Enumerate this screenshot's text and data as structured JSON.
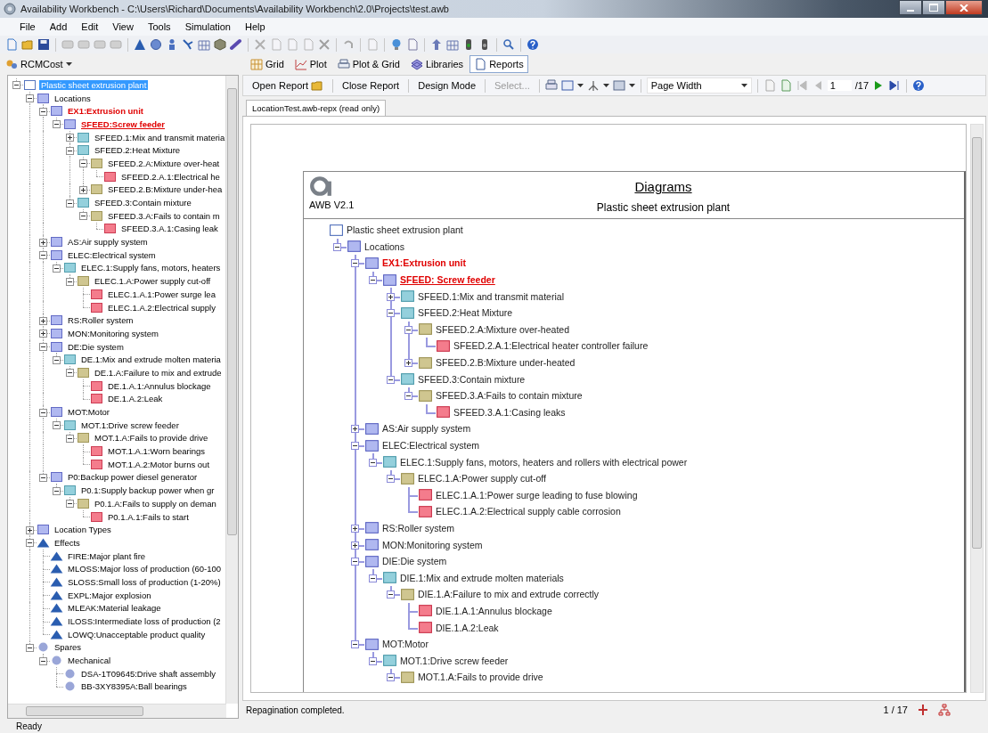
{
  "window": {
    "title": "Availability Workbench - C:\\Users\\Richard\\Documents\\Availability Workbench\\2.0\\Projects\\test.awb"
  },
  "menu": [
    "File",
    "Add",
    "Edit",
    "View",
    "Tools",
    "Simulation",
    "Help"
  ],
  "navigator": {
    "module": "RCMCost",
    "tree": [
      {
        "label": "Plastic sheet extrusion plant",
        "kind": "root",
        "selected": true,
        "expanded": true,
        "children": [
          {
            "label": "Locations",
            "kind": "location",
            "selected": false,
            "expanded": true,
            "children": [
              {
                "label": "EX1:Extrusion unit",
                "kind": "location",
                "color": "#e00000",
                "selected": false,
                "expanded": true,
                "children": [
                  {
                    "label": "SFEED:Screw feeder",
                    "kind": "location",
                    "color": "#e00000",
                    "underlined": true,
                    "selected": false,
                    "expanded": true,
                    "children": [
                      {
                        "label": "SFEED.1:Mix and transmit materia",
                        "kind": "function",
                        "selected": false,
                        "expanded": false
                      },
                      {
                        "label": "SFEED.2:Heat Mixture",
                        "kind": "function",
                        "selected": false,
                        "expanded": true,
                        "children": [
                          {
                            "label": "SFEED.2.A:Mixture over-heat",
                            "kind": "failure",
                            "selected": false,
                            "expanded": true,
                            "children": [
                              {
                                "label": "SFEED.2.A.1:Electrical he",
                                "kind": "cause",
                                "selected": false
                              }
                            ]
                          },
                          {
                            "label": "SFEED.2.B:Mixture under-hea",
                            "kind": "failure",
                            "selected": false,
                            "expanded": false
                          }
                        ]
                      },
                      {
                        "label": "SFEED.3:Contain mixture",
                        "kind": "function",
                        "selected": false,
                        "expanded": true,
                        "children": [
                          {
                            "label": "SFEED.3.A:Fails to contain m",
                            "kind": "failure",
                            "selected": false,
                            "expanded": true,
                            "children": [
                              {
                                "label": "SFEED.3.A.1:Casing leak",
                                "kind": "cause",
                                "selected": false
                              }
                            ]
                          }
                        ]
                      }
                    ]
                  }
                ]
              },
              {
                "label": "AS:Air supply system",
                "kind": "location",
                "selected": false,
                "expanded": false
              },
              {
                "label": "ELEC:Electrical system",
                "kind": "location",
                "selected": false,
                "expanded": true,
                "children": [
                  {
                    "label": "ELEC.1:Supply fans, motors, heaters",
                    "kind": "function",
                    "selected": false,
                    "expanded": true,
                    "children": [
                      {
                        "label": "ELEC.1.A:Power supply cut-off",
                        "kind": "failure",
                        "selected": false,
                        "expanded": true,
                        "children": [
                          {
                            "label": "ELEC.1.A.1:Power surge lea",
                            "kind": "cause",
                            "selected": false
                          },
                          {
                            "label": "ELEC.1.A.2:Electrical supply",
                            "kind": "cause",
                            "selected": false
                          }
                        ]
                      }
                    ]
                  }
                ]
              },
              {
                "label": "RS:Roller system",
                "kind": "location",
                "selected": false,
                "expanded": false
              },
              {
                "label": "MON:Monitoring system",
                "kind": "location",
                "selected": false,
                "expanded": false
              },
              {
                "label": "DE:Die system",
                "kind": "location",
                "selected": false,
                "expanded": true,
                "children": [
                  {
                    "label": "DE.1:Mix and extrude molten materia",
                    "kind": "function",
                    "selected": false,
                    "expanded": true,
                    "children": [
                      {
                        "label": "DE.1.A:Failure to mix and extrude",
                        "kind": "failure",
                        "selected": false,
                        "expanded": true,
                        "children": [
                          {
                            "label": "DE.1.A.1:Annulus blockage",
                            "kind": "cause",
                            "selected": false
                          },
                          {
                            "label": "DE.1.A.2:Leak",
                            "kind": "cause",
                            "selected": false
                          }
                        ]
                      }
                    ]
                  }
                ]
              },
              {
                "label": "MOT:Motor",
                "kind": "location",
                "selected": false,
                "expanded": true,
                "children": [
                  {
                    "label": "MOT.1:Drive screw feeder",
                    "kind": "function",
                    "selected": false,
                    "expanded": true,
                    "children": [
                      {
                        "label": "MOT.1.A:Fails to provide drive",
                        "kind": "failure",
                        "selected": false,
                        "expanded": true,
                        "children": [
                          {
                            "label": "MOT.1.A.1:Worn bearings",
                            "kind": "cause",
                            "selected": false
                          },
                          {
                            "label": "MOT.1.A.2:Motor burns out",
                            "kind": "cause",
                            "selected": false
                          }
                        ]
                      }
                    ]
                  }
                ]
              },
              {
                "label": "P0:Backup power diesel generator",
                "kind": "location",
                "selected": false,
                "expanded": true,
                "children": [
                  {
                    "label": "P0.1:Supply backup power when gr",
                    "kind": "function",
                    "selected": false,
                    "expanded": true,
                    "children": [
                      {
                        "label": "P0.1.A:Fails to supply on deman",
                        "kind": "failure",
                        "selected": false,
                        "expanded": true,
                        "children": [
                          {
                            "label": "P0.1.A.1:Fails to start",
                            "kind": "cause",
                            "selected": false
                          }
                        ]
                      }
                    ]
                  }
                ]
              }
            ]
          },
          {
            "label": "Location Types",
            "kind": "location",
            "selected": false,
            "expanded": false
          },
          {
            "label": "Effects",
            "kind": "effect",
            "selected": false,
            "expanded": true,
            "children": [
              {
                "label": "FIRE:Major plant fire",
                "kind": "effect",
                "selected": false
              },
              {
                "label": "MLOSS:Major loss of production (60-100",
                "kind": "effect",
                "selected": false
              },
              {
                "label": "SLOSS:Small loss of production (1-20%)",
                "kind": "effect",
                "selected": false
              },
              {
                "label": "EXPL:Major explosion",
                "kind": "effect",
                "selected": false
              },
              {
                "label": "MLEAK:Material leakage",
                "kind": "effect",
                "selected": false
              },
              {
                "label": "ILOSS:Intermediate loss of production (2",
                "kind": "effect",
                "selected": false
              },
              {
                "label": "LOWQ:Unacceptable product quality",
                "kind": "effect",
                "selected": false
              }
            ]
          },
          {
            "label": "Spares",
            "kind": "spare",
            "selected": false,
            "expanded": true,
            "children": [
              {
                "label": "Mechanical",
                "kind": "spare",
                "selected": false,
                "expanded": true,
                "children": [
                  {
                    "label": "DSA-1T09645:Drive shaft assembly",
                    "kind": "spare",
                    "selected": false
                  },
                  {
                    "label": "BB-3XY8395A:Ball bearings",
                    "kind": "spare",
                    "selected": false
                  }
                ]
              }
            ]
          }
        ]
      }
    ]
  },
  "view_tabs": [
    {
      "label": "Grid",
      "selected": false
    },
    {
      "label": "Plot",
      "selected": false
    },
    {
      "label": "Plot & Grid",
      "selected": false
    },
    {
      "label": "Libraries",
      "selected": false
    },
    {
      "label": "Reports",
      "selected": true
    }
  ],
  "report_toolbar": {
    "buttons": [
      {
        "label": "Open Report",
        "disabled": false
      },
      {
        "label": "Close Report",
        "disabled": false
      },
      {
        "label": "Design Mode",
        "disabled": false
      },
      {
        "label": "Select...",
        "disabled": true
      }
    ],
    "zoom": "Page Width",
    "page": "1",
    "page_total": "/17"
  },
  "document_tab": "LocationTest.awb-repx (read only)",
  "report": {
    "logo_caption": "AWB V2.1",
    "heading": "Diagrams",
    "subtitle": "Plastic sheet extrusion plant",
    "tree": [
      {
        "label": "Plastic sheet extrusion plant",
        "kind": "root",
        "children": [
          {
            "label": "Locations",
            "kind": "location",
            "expanded": true,
            "children": [
              {
                "label": "EX1:Extrusion unit",
                "kind": "location",
                "color": "#e00000",
                "expanded": true,
                "children": [
                  {
                    "label": "SFEED: Screw feeder",
                    "kind": "location",
                    "color": "#e00000",
                    "underlined": true,
                    "expanded": true,
                    "children": [
                      {
                        "label": "SFEED.1:Mix and transmit material",
                        "kind": "function",
                        "expanded": false
                      },
                      {
                        "label": "SFEED.2:Heat Mixture",
                        "kind": "function",
                        "expanded": true,
                        "children": [
                          {
                            "label": "SFEED.2.A:Mixture over-heated",
                            "kind": "failure",
                            "expanded": true,
                            "children": [
                              {
                                "label": "SFEED.2.A.1:Electrical heater controller failure",
                                "kind": "cause"
                              }
                            ]
                          },
                          {
                            "label": "SFEED.2.B:Mixture under-heated",
                            "kind": "failure",
                            "expanded": false
                          }
                        ]
                      },
                      {
                        "label": "SFEED.3:Contain mixture",
                        "kind": "function",
                        "expanded": true,
                        "children": [
                          {
                            "label": "SFEED.3.A:Fails to contain mixture",
                            "kind": "failure",
                            "expanded": true,
                            "children": [
                              {
                                "label": "SFEED.3.A.1:Casing leaks",
                                "kind": "cause"
                              }
                            ]
                          }
                        ]
                      }
                    ]
                  }
                ]
              },
              {
                "label": "AS:Air supply system",
                "kind": "location",
                "expanded": false
              },
              {
                "label": "ELEC:Electrical system",
                "kind": "location",
                "expanded": true,
                "children": [
                  {
                    "label": "ELEC.1:Supply fans, motors, heaters and rollers with electrical power",
                    "kind": "function",
                    "expanded": true,
                    "children": [
                      {
                        "label": "ELEC.1.A:Power supply cut-off",
                        "kind": "failure",
                        "expanded": true,
                        "children": [
                          {
                            "label": "ELEC.1.A.1:Power surge leading to fuse blowing",
                            "kind": "cause"
                          },
                          {
                            "label": "ELEC.1.A.2:Electrical supply cable corrosion",
                            "kind": "cause"
                          }
                        ]
                      }
                    ]
                  }
                ]
              },
              {
                "label": "RS:Roller system",
                "kind": "location",
                "expanded": false
              },
              {
                "label": "MON:Monitoring system",
                "kind": "location",
                "expanded": false
              },
              {
                "label": "DIE:Die system",
                "kind": "location",
                "expanded": true,
                "children": [
                  {
                    "label": "DIE.1:Mix and extrude molten materials",
                    "kind": "function",
                    "expanded": true,
                    "children": [
                      {
                        "label": "DIE.1.A:Failure to mix and extrude correctly",
                        "kind": "failure",
                        "expanded": true,
                        "children": [
                          {
                            "label": "DIE.1.A.1:Annulus blockage",
                            "kind": "cause"
                          },
                          {
                            "label": "DIE.1.A.2:Leak",
                            "kind": "cause"
                          }
                        ]
                      }
                    ]
                  }
                ]
              },
              {
                "label": "MOT:Motor",
                "kind": "location",
                "expanded": true,
                "children": [
                  {
                    "label": "MOT.1:Drive screw feeder",
                    "kind": "function",
                    "expanded": true,
                    "children": [
                      {
                        "label": "MOT.1.A:Fails to provide drive",
                        "kind": "failure",
                        "expanded": true
                      }
                    ]
                  }
                ]
              }
            ]
          }
        ]
      }
    ]
  },
  "viewer_status": {
    "message": "Repagination completed.",
    "pages": "1 / 17"
  },
  "status_bar": "Ready"
}
